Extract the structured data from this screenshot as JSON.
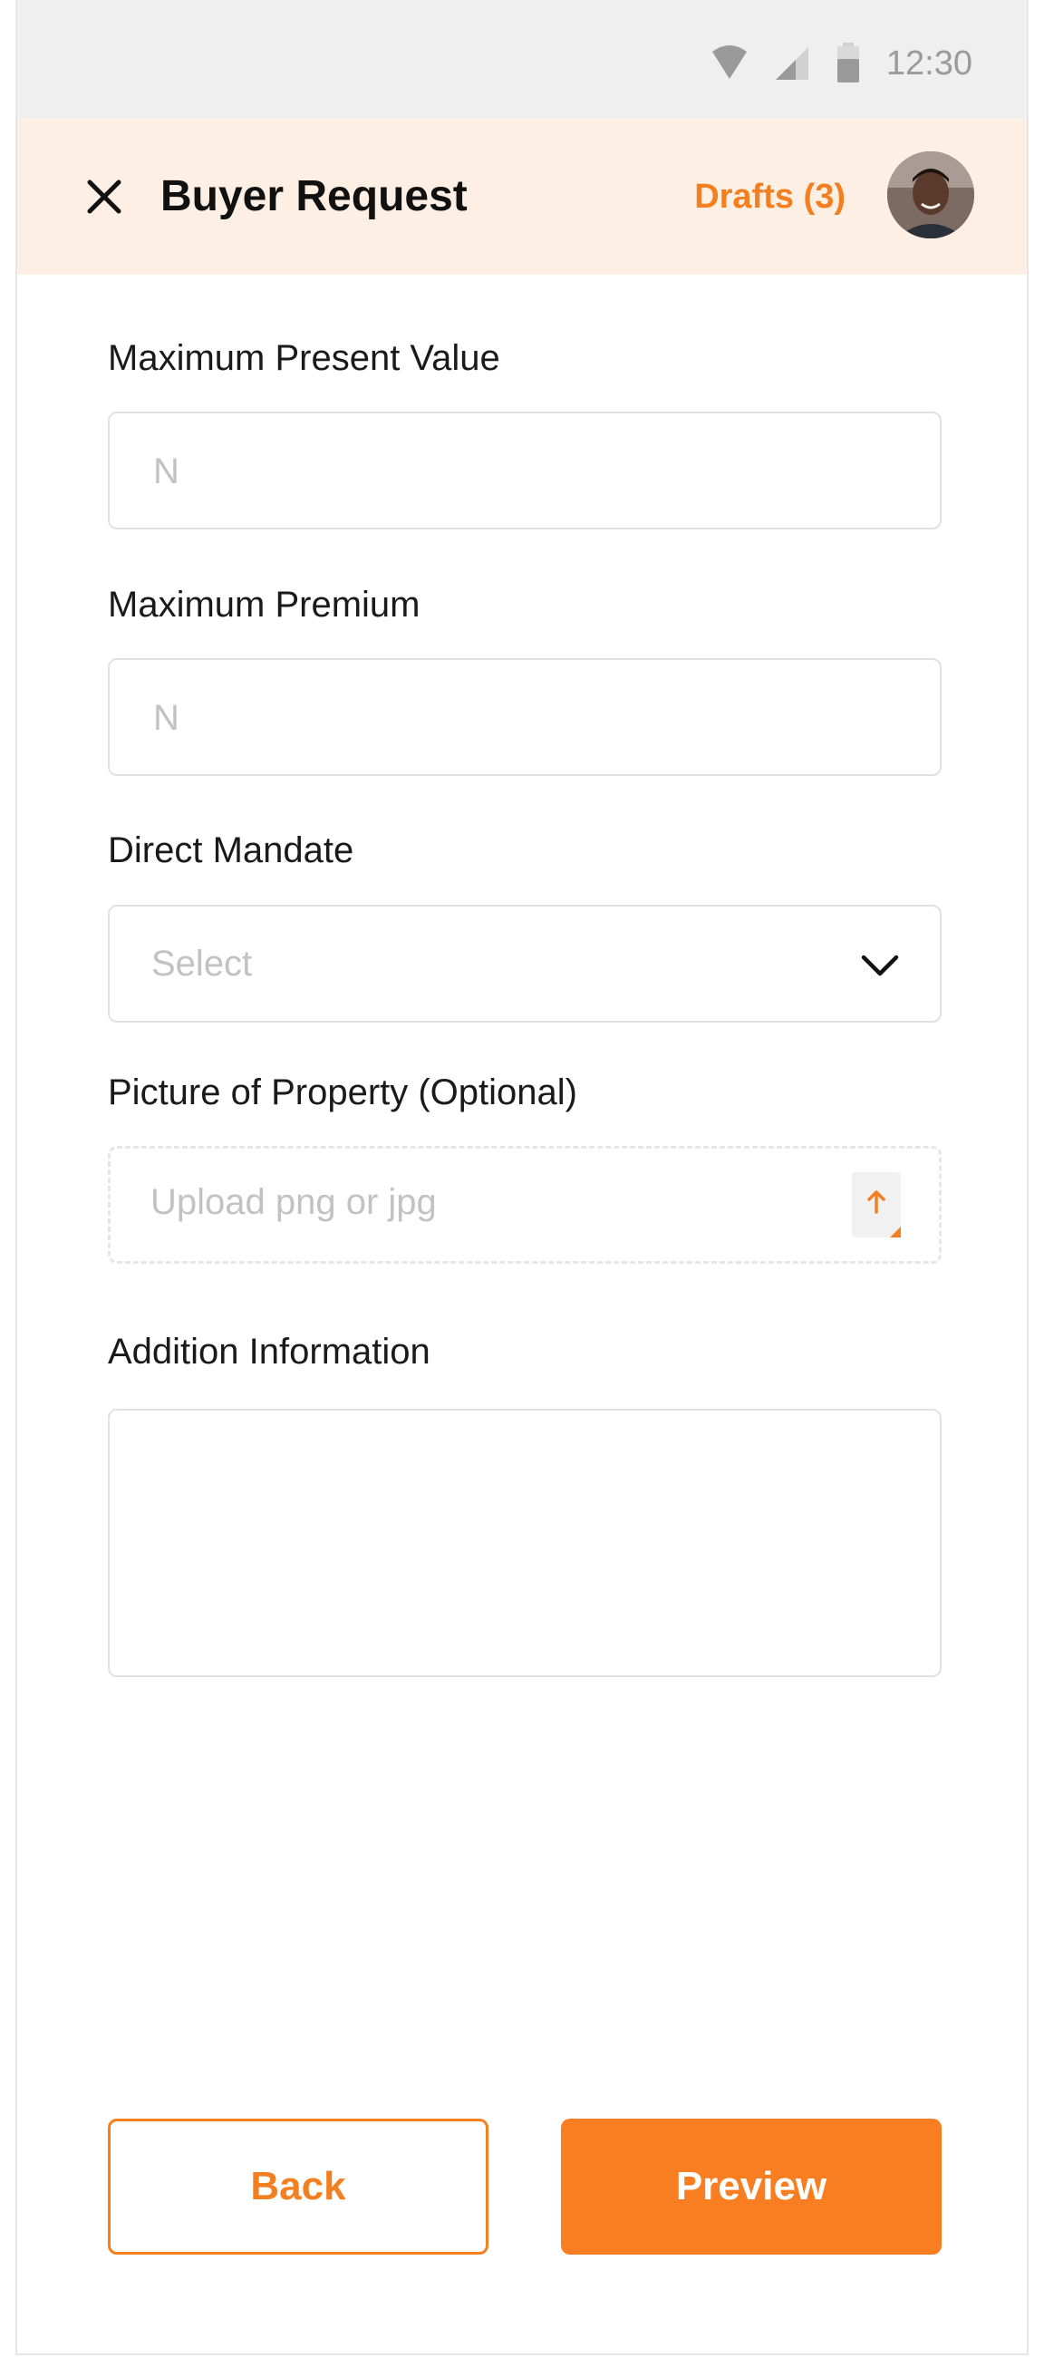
{
  "status_bar": {
    "time": "12:30",
    "icons": [
      "wifi-icon",
      "signal-icon",
      "battery-icon"
    ]
  },
  "header": {
    "title": "Buyer Request",
    "drafts_label": "Drafts (3)",
    "close_icon": "close-icon"
  },
  "form": {
    "max_present_value": {
      "label": "Maximum Present Value",
      "placeholder": "N",
      "value": ""
    },
    "max_premium": {
      "label": "Maximum Premium",
      "placeholder": "N",
      "value": ""
    },
    "direct_mandate": {
      "label": "Direct Mandate",
      "selected": "Select"
    },
    "picture": {
      "label": "Picture of Property (Optional)",
      "placeholder": "Upload png or jpg"
    },
    "additional_info": {
      "label": "Addition Information",
      "value": ""
    }
  },
  "actions": {
    "back_label": "Back",
    "preview_label": "Preview"
  },
  "colors": {
    "accent": "#F47F20",
    "header_bg": "#FDEFE4",
    "status_bg": "#EFEFEF"
  }
}
